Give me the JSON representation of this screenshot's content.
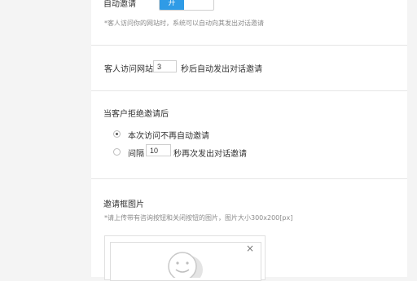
{
  "auto_invite": {
    "label": "自动邀请",
    "toggle_on": "开",
    "hint": "*客人访问你的网站时，系统可以自动向其发出对话邀请"
  },
  "visit_delay": {
    "prefix": "客人访问网站",
    "value": "3",
    "suffix": "秒后自动发出对话邀请"
  },
  "after_reject": {
    "title": "当客户拒绝邀请后",
    "option_once": "本次访问不再自动邀请",
    "option_interval_prefix": "间隔",
    "option_interval_value": "10",
    "option_interval_suffix": "秒再次发出对话邀请",
    "selected": "option_once"
  },
  "invite_image": {
    "title": "邀请框图片",
    "hint": "*请上传带有咨询按钮和关闭按钮的图片，图片大小300x200[px]",
    "close_symbol": "×"
  },
  "colors": {
    "accent": "#2f9be6",
    "background": "#f4f4f4",
    "card": "#ffffff"
  },
  "icons": {
    "close": "close-icon",
    "placeholder": "smiley-icon"
  }
}
